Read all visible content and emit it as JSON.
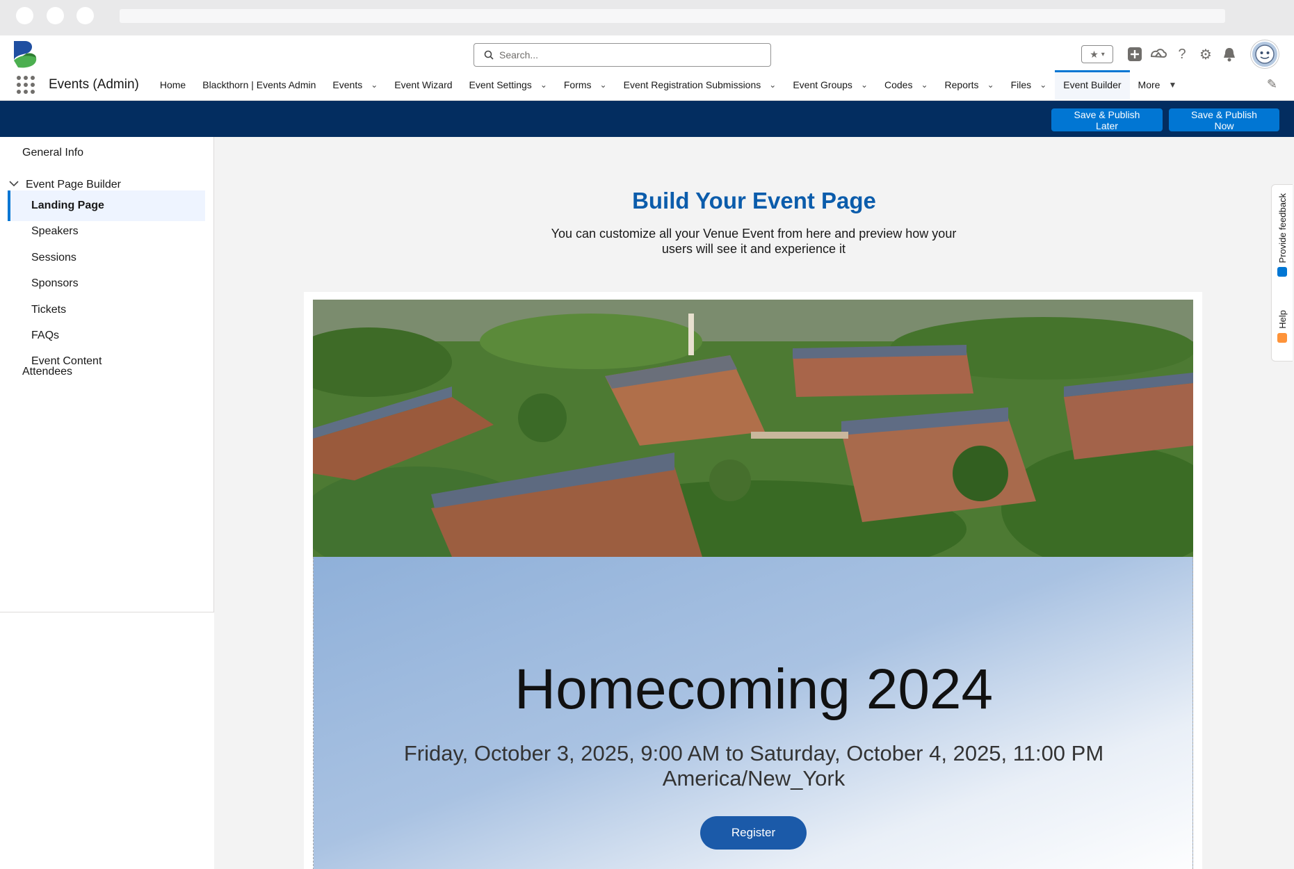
{
  "app": {
    "name": "Events (Admin)"
  },
  "search": {
    "placeholder": "Search..."
  },
  "nav": {
    "items": [
      {
        "label": "Home",
        "dropdown": false
      },
      {
        "label": "Blackthorn | Events Admin",
        "dropdown": false
      },
      {
        "label": "Events",
        "dropdown": true
      },
      {
        "label": "Event Wizard",
        "dropdown": false
      },
      {
        "label": "Event Settings",
        "dropdown": true
      },
      {
        "label": "Forms",
        "dropdown": true
      },
      {
        "label": "Event Registration Submissions",
        "dropdown": true
      },
      {
        "label": "Event Groups",
        "dropdown": true
      },
      {
        "label": "Codes",
        "dropdown": true
      },
      {
        "label": "Reports",
        "dropdown": true
      },
      {
        "label": "Files",
        "dropdown": true
      },
      {
        "label": "Event Builder",
        "dropdown": false,
        "active": true
      },
      {
        "label": "More",
        "dropdown": true
      }
    ]
  },
  "actions": {
    "publish_later": "Save & Publish Later",
    "publish_now": "Save & Publish Now"
  },
  "sidebar": {
    "general_info": "General Info",
    "builder": "Event Page Builder",
    "sub_items": [
      "Landing Page",
      "Speakers",
      "Sessions",
      "Sponsors",
      "Tickets",
      "FAQs",
      "Event Content"
    ],
    "selected": "Landing Page",
    "attendees": "Attendees"
  },
  "main": {
    "title": "Build Your Event Page",
    "description": "You can customize all your Venue Event from here and preview how your users will see it and experience it"
  },
  "event": {
    "title": "Homecoming 2024",
    "date": "Friday, October 3, 2025, 9:00 AM to Saturday, October 4, 2025, 11:00 PM America/New_York",
    "register_label": "Register"
  },
  "rail": {
    "feedback": "Provide feedback",
    "help": "Help"
  },
  "colors": {
    "brand": "#0176d3",
    "action_bar": "#032d60",
    "title": "#0b5cab",
    "register": "#1b5aa9"
  }
}
